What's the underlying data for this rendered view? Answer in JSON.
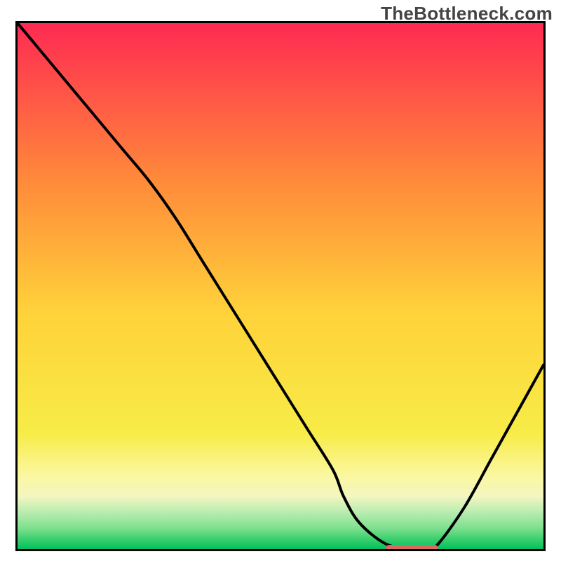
{
  "watermark": "TheBottleneck.com",
  "colors": {
    "top": "#ff2a52",
    "mid1": "#ff8a3a",
    "mid2": "#ffd23a",
    "mid3": "#f7ec47",
    "band_y1": "#fbf7a0",
    "band_y2": "#f3f6c0",
    "band_g1": "#b9ecb0",
    "band_g2": "#7ee08f",
    "band_g3": "#3ed06f",
    "bottom": "#00c060",
    "curve": "#000000",
    "marker": "#d86a60"
  },
  "chart_data": {
    "type": "line",
    "title": "",
    "xlabel": "",
    "ylabel": "",
    "xlim": [
      0,
      100
    ],
    "ylim": [
      0,
      100
    ],
    "x": [
      0,
      5,
      10,
      15,
      20,
      25,
      30,
      35,
      40,
      45,
      50,
      55,
      60,
      62,
      65,
      70,
      75,
      78,
      80,
      85,
      90,
      95,
      100
    ],
    "values": [
      100,
      94,
      88,
      82,
      76,
      70,
      63,
      55,
      47,
      39,
      31,
      23,
      15,
      10,
      5,
      1,
      0,
      0,
      1,
      8,
      17,
      26,
      35
    ],
    "minimum_band_x": [
      70,
      80
    ],
    "minimum_y": 0
  }
}
